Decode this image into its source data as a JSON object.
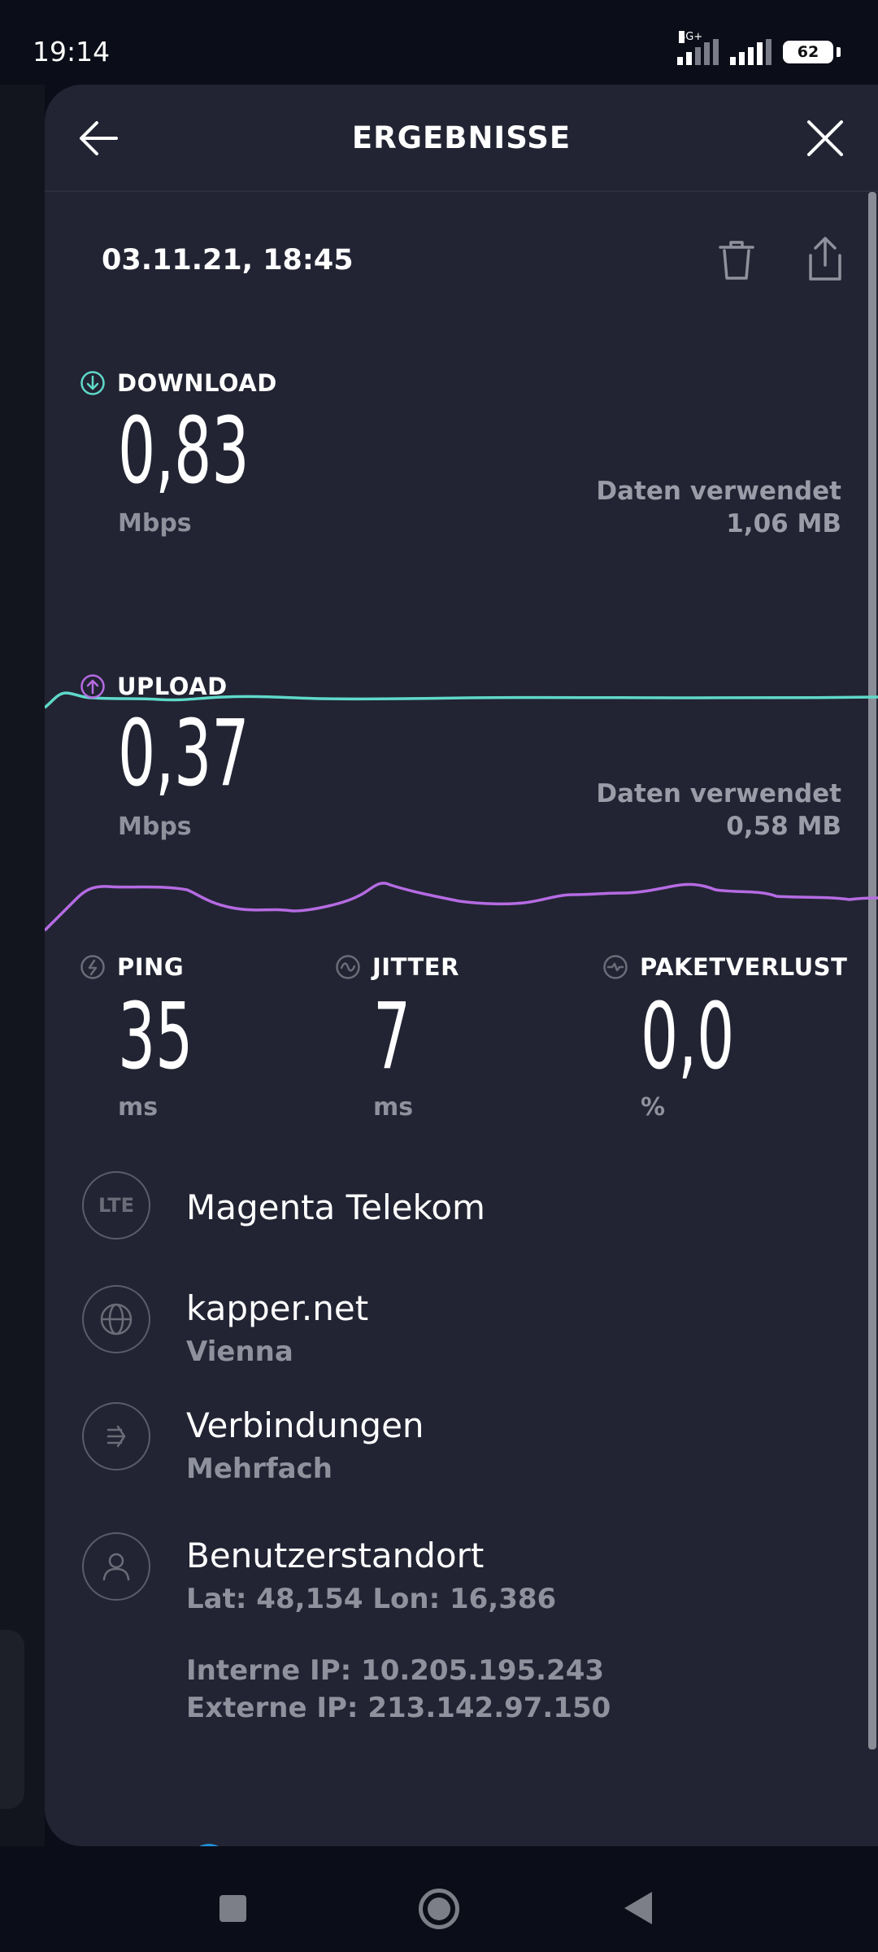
{
  "status_bar": {
    "time": "19:14",
    "network_type": "4G+",
    "battery": "62"
  },
  "header": {
    "title": "ERGEBNISSE",
    "back_icon": "arrow-left-icon",
    "close_icon": "close-icon"
  },
  "result": {
    "date": "03.11.21, 18:45",
    "delete_icon": "trash-icon",
    "share_icon": "share-icon"
  },
  "download": {
    "label": "DOWNLOAD",
    "value": "0,83",
    "unit": "Mbps",
    "data_used_label": "Daten verwendet",
    "data_used_value": "1,06 MB",
    "color": "#5fd9c9"
  },
  "upload": {
    "label": "UPLOAD",
    "value": "0,37",
    "unit": "Mbps",
    "data_used_label": "Daten verwendet",
    "data_used_value": "0,58 MB",
    "color": "#b66be3"
  },
  "ping": {
    "label": "PING",
    "value": "35",
    "unit": "ms"
  },
  "jitter": {
    "label": "JITTER",
    "value": "7",
    "unit": "ms"
  },
  "packet_loss": {
    "label": "PAKETVERLUST",
    "value": "0,0",
    "unit": "%"
  },
  "details": {
    "provider": {
      "icon_text": "LTE",
      "title": "Magenta Telekom"
    },
    "server": {
      "title": "kapper.net",
      "subtitle": "Vienna"
    },
    "connections": {
      "title": "Verbindungen",
      "subtitle": "Mehrfach"
    },
    "location": {
      "title": "Benutzerstandort",
      "subtitle": "Lat: 48,154 Lon: 16,386"
    },
    "internal_ip": "Interne IP: 10.205.195.243",
    "external_ip": "Externe IP: 213.142.97.150"
  },
  "colors": {
    "background": "#222433",
    "accent_download": "#5fd9c9",
    "accent_upload": "#b66be3"
  }
}
